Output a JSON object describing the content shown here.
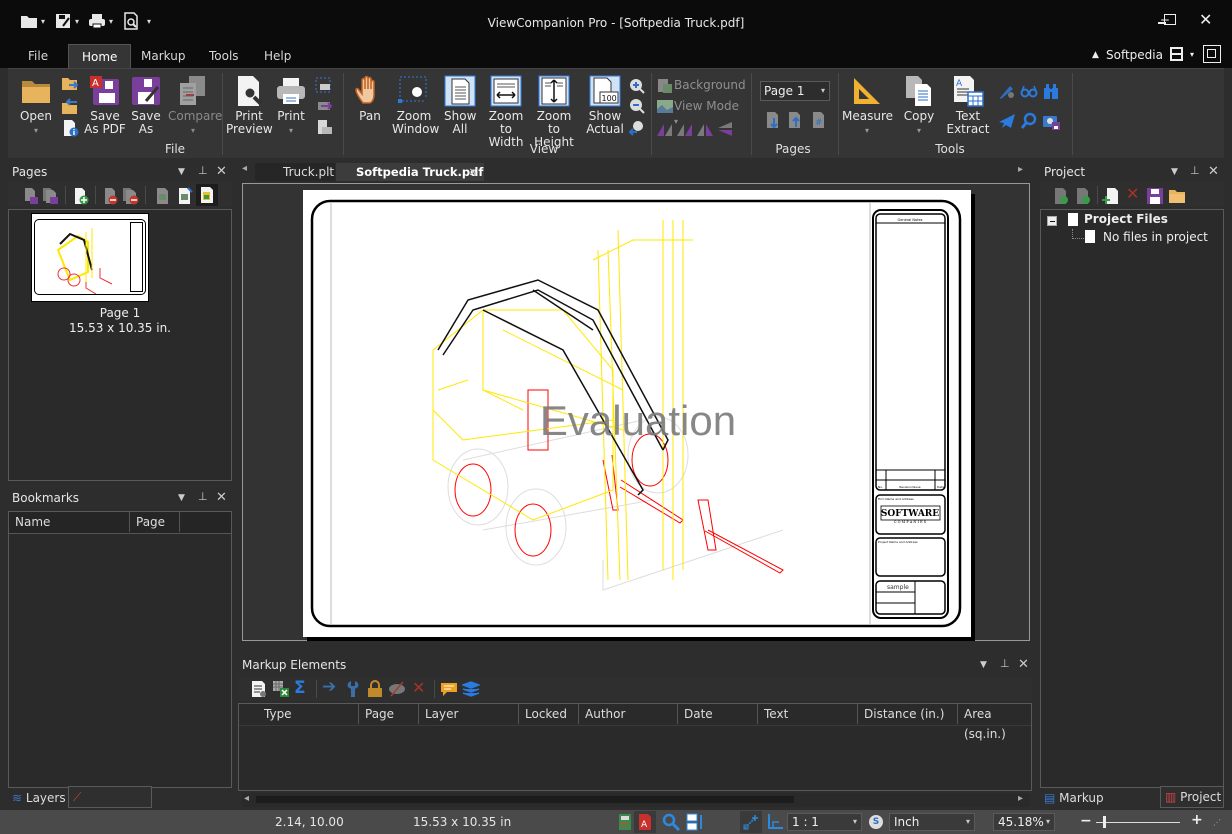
{
  "app": {
    "title": "ViewCompanion Pro - [Softpedia Truck.pdf]",
    "user": "Softpedia",
    "window_controls": [
      "minimize",
      "maximize",
      "close"
    ]
  },
  "quick_access": {
    "icons": [
      "open-folder-icon",
      "save-icon",
      "print-icon",
      "print-preview-icon"
    ],
    "customize_glyph": "▾"
  },
  "ribbon": {
    "tabs": [
      {
        "label": "File",
        "active": false
      },
      {
        "label": "Home",
        "active": true
      },
      {
        "label": "Markup",
        "active": false
      },
      {
        "label": "Tools",
        "active": false
      },
      {
        "label": "Help",
        "active": false
      }
    ],
    "groups": {
      "file": {
        "label": "File",
        "buttons": [
          {
            "label": "Open",
            "has_dropdown": true
          },
          {
            "label": "Save As PDF"
          },
          {
            "label": "Save As"
          },
          {
            "label": "Compare",
            "disabled": true,
            "has_dropdown": true
          }
        ],
        "print_label": "Print Preview",
        "print2_label": "Print"
      },
      "view": {
        "label": "View",
        "buttons": [
          {
            "label": "Pan"
          },
          {
            "label": "Zoom Window"
          },
          {
            "label": "Show All"
          },
          {
            "label": "Zoom to Width"
          },
          {
            "label": "Zoom to Height"
          },
          {
            "label": "Show Actual"
          }
        ],
        "background_label": "Background",
        "viewmode_label": "View Mode"
      },
      "pages": {
        "label": "Pages",
        "page_select": "Page 1"
      },
      "tools": {
        "label": "Tools",
        "buttons": [
          {
            "label": "Measure",
            "has_dropdown": true
          },
          {
            "label": "Copy",
            "has_dropdown": true
          },
          {
            "label": "Text Extract"
          }
        ]
      }
    }
  },
  "pages_panel": {
    "title": "Pages",
    "thumbnail": {
      "label": "Page 1",
      "size": "15.53 x 10.35 in."
    }
  },
  "bookmarks_panel": {
    "title": "Bookmarks",
    "columns": [
      "Name",
      "Page",
      ""
    ]
  },
  "left_bottom_tabs": [
    {
      "label": "Layers",
      "active": false
    },
    {
      "label": "Bookmarks",
      "active": true
    }
  ],
  "doc_tabs": [
    {
      "label": "Truck.plt",
      "active": false
    },
    {
      "label": "Softpedia Truck.pdf",
      "active": true
    }
  ],
  "drawing": {
    "watermark": "Evaluation",
    "titleblock": {
      "notes_header": "General Notes",
      "revision_cols": [
        "No.",
        "Revision/Issue",
        "Date"
      ],
      "firm": "Firm Name and Address",
      "logo_text": "SOFTWARE",
      "logo_sub": "C O M P A N I E S",
      "project": "Project Name and Address",
      "sample_field": "sample"
    }
  },
  "project_panel": {
    "title": "Project",
    "tree": {
      "root": "Project Files",
      "child": "No files in project"
    }
  },
  "markup_panel": {
    "title": "Markup Elements",
    "columns": [
      "Type",
      "Page",
      "Layer",
      "Locked",
      "Author",
      "Date",
      "Text",
      "Distance (in.)",
      "Area (sq.in.)"
    ]
  },
  "right_bottom_tabs": [
    {
      "label": "Markup Properties",
      "active": false
    },
    {
      "label": "Project",
      "active": true
    }
  ],
  "statusbar": {
    "coords": "2.14, 10.00",
    "page_size": "15.53 x 10.35 in",
    "scale": "1 : 1",
    "units": "Inch",
    "zoom": "45.18%",
    "zoom_slider_fraction": 0.08
  }
}
